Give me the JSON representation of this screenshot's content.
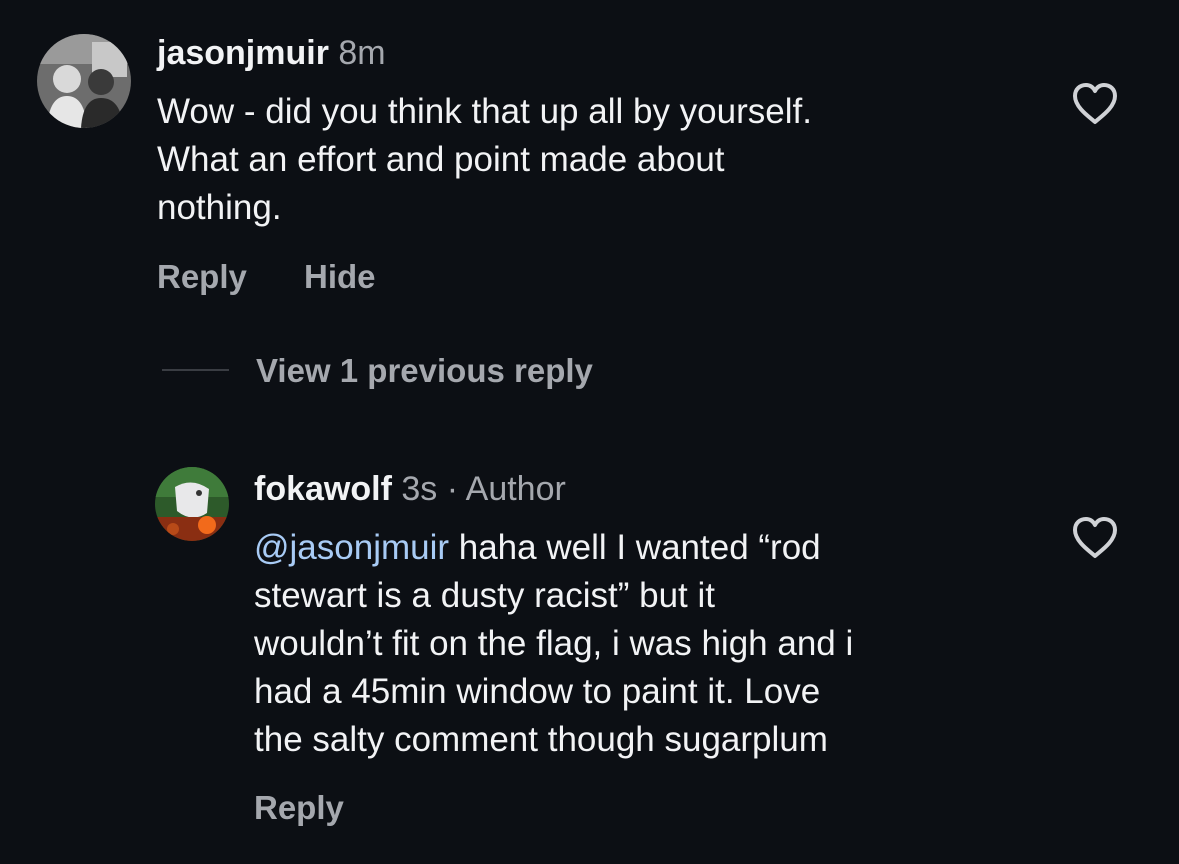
{
  "comments": [
    {
      "username": "jasonjmuir",
      "time": "8m",
      "lines": [
        "Wow - did you think that up all by yourself.",
        "What an effort and point made about",
        "nothing."
      ],
      "actions": {
        "reply": "Reply",
        "hide": "Hide"
      },
      "avatar_icon": "profile-photo"
    }
  ],
  "thread": {
    "view_previous": "View 1 previous reply"
  },
  "reply": {
    "username": "fokawolf",
    "time": "3s",
    "separator": "·",
    "badge": "Author",
    "mention": "@jasonjmuir",
    "first_line_rest": " haha well I wanted “rod",
    "lines": [
      "stewart is a dusty racist” but it",
      "wouldn’t fit on the flag, i was high and i",
      "had a 45min window to paint it. Love",
      "the salty comment though sugarplum"
    ],
    "actions": {
      "reply": "Reply"
    },
    "avatar_icon": "profile-photo"
  },
  "icons": {
    "like": "heart-outline-icon"
  },
  "colors": {
    "background": "#0c0f14",
    "text": "#f2f3f5",
    "secondary": "#a5a8ae",
    "mention": "#a8cbf5"
  }
}
